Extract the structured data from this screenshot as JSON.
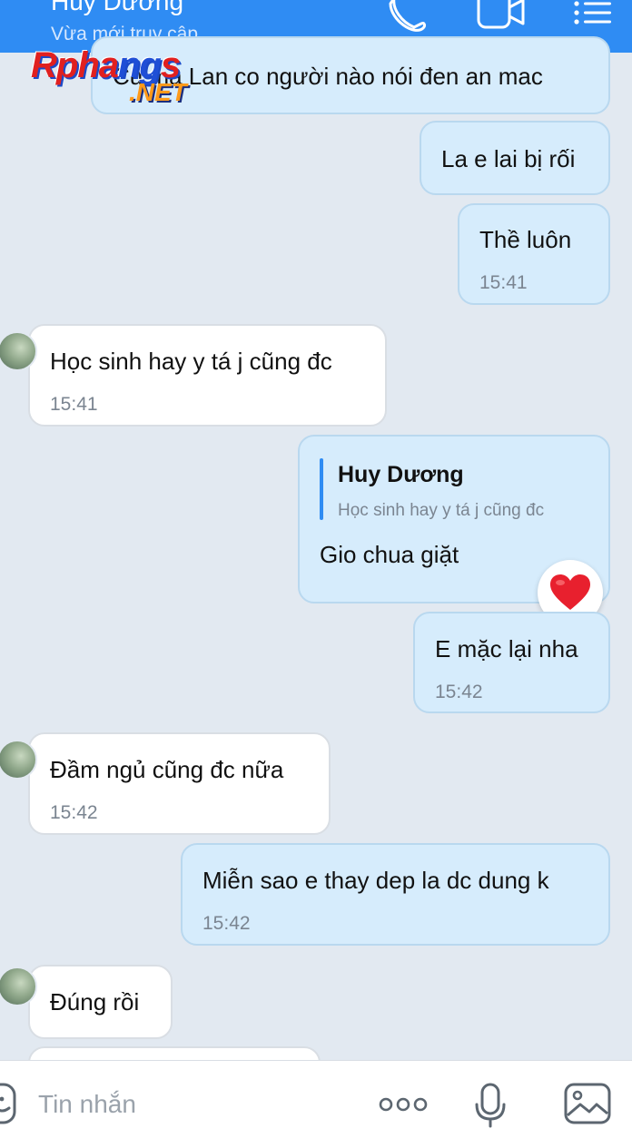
{
  "header": {
    "contact_name": "Huy Dương",
    "status": "Vừa mới truy cập",
    "icons": [
      "phone-icon",
      "video-call-icon",
      "menu-icon"
    ]
  },
  "watermark": {
    "main": "Rphangs",
    "sub": ".NET"
  },
  "messages": [
    {
      "id": "m1",
      "direction": "outgoing",
      "text": "Cũ mà Lan co người nào nói đen an mac",
      "time": ""
    },
    {
      "id": "m2",
      "direction": "outgoing",
      "text": "La e lai bị rối",
      "time": ""
    },
    {
      "id": "m3",
      "direction": "outgoing",
      "text": "Thề luôn",
      "time": "15:41"
    },
    {
      "id": "m4",
      "direction": "incoming",
      "text": "Học sinh hay y tá j cũng đc",
      "time": "15:41"
    },
    {
      "id": "m5",
      "direction": "outgoing",
      "quote": {
        "name": "Huy Dương",
        "text": "Học sinh hay y tá j cũng đc"
      },
      "text": "Gio chua giặt",
      "reaction": "heart"
    },
    {
      "id": "m6",
      "direction": "outgoing",
      "text": "E mặc lại nha",
      "time": "15:42"
    },
    {
      "id": "m7",
      "direction": "incoming",
      "text": "Đầm ngủ cũng đc nữa",
      "time": "15:42"
    },
    {
      "id": "m8",
      "direction": "outgoing",
      "text": "Miễn sao e thay dep la dc dung k",
      "time": "15:42"
    },
    {
      "id": "m9",
      "direction": "incoming",
      "text": "Đúng rồi",
      "time": ""
    }
  ],
  "composer": {
    "placeholder": "Tin nhắn",
    "icons": [
      "sticker-icon",
      "more-icon",
      "microphone-icon",
      "image-icon"
    ]
  },
  "colors": {
    "header_bg": "#2f8cf3",
    "chat_bg": "#e2e9f1",
    "outgoing_bubble": "#d6ecfc",
    "incoming_bubble": "#ffffff",
    "reaction_heart": "#e8202e"
  }
}
